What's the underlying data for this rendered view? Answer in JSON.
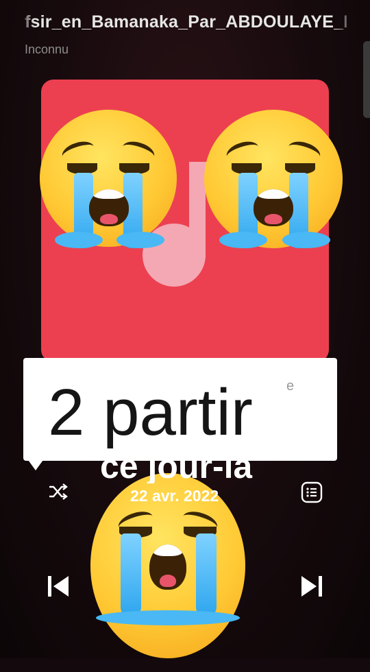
{
  "player": {
    "title": "fsir_en_Bamanaka_Par_ABDOULAYE_K",
    "artist": "Inconnu",
    "date": "22 avr. 2022"
  },
  "overlay": {
    "caption": "2 partir",
    "caption_mark": "e",
    "subtitle": "ce jour-la"
  },
  "icons": {
    "shuffle": "shuffle-icon",
    "playlist": "playlist-icon",
    "previous": "skip-previous-icon",
    "next": "skip-next-icon",
    "cover": "music-note-icon",
    "sticker": "loudly-crying-face-emoji"
  },
  "colors": {
    "album_bg": "#ec4050",
    "note": "#f4a8b4",
    "background": "#140a0d"
  }
}
